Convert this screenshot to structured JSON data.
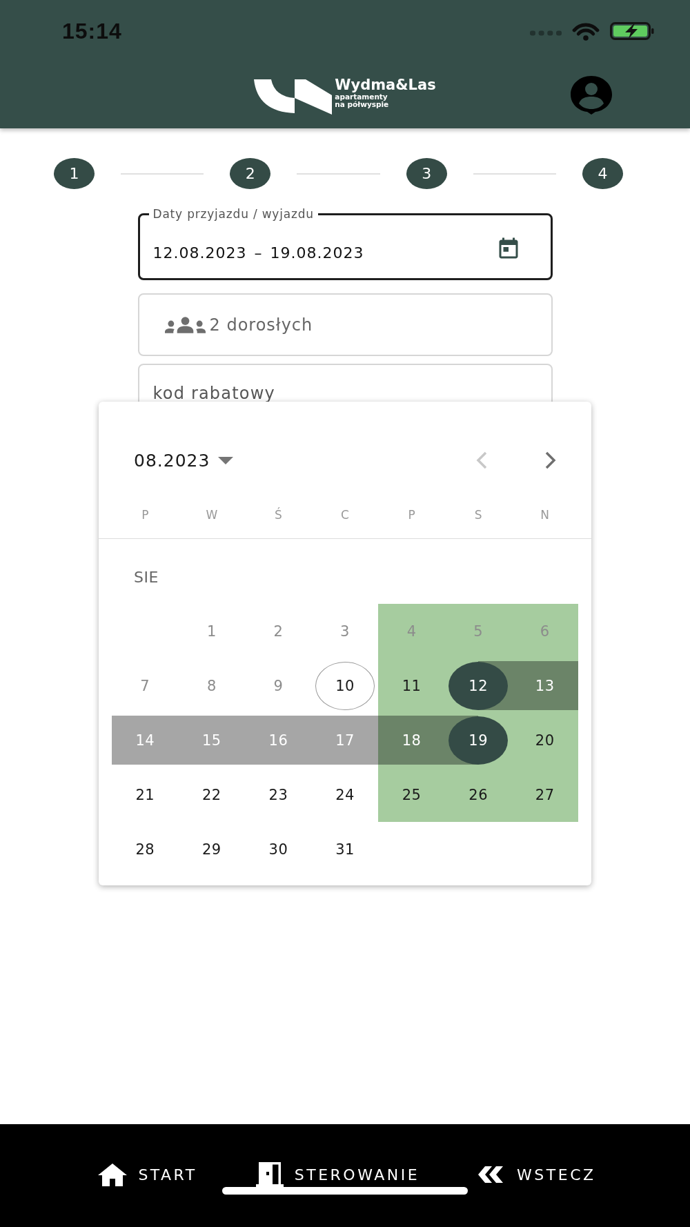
{
  "status_bar": {
    "time": "15:14"
  },
  "header": {
    "brand": {
      "name": "Wydma&Las",
      "tagline": [
        "apartamenty",
        "na półwyspie"
      ]
    }
  },
  "stepper": {
    "steps": [
      "1",
      "2",
      "3",
      "4"
    ]
  },
  "booking_form": {
    "dates": {
      "label": "Daty przyjazdu / wyjazdu",
      "value": "12.08.2023 – 19.08.2023",
      "focused": true
    },
    "guests": {
      "value": "2 dorosłych",
      "focused": false
    },
    "discount_code": {
      "placeholder": "kod rabatowy",
      "focused": false
    }
  },
  "date_picker": {
    "period": "08.2023",
    "prev_disabled": true,
    "next_disabled": false,
    "weekdays": [
      "P",
      "W",
      "Ś",
      "C",
      "P",
      "S",
      "N"
    ],
    "month_label": "SIE",
    "weeks": [
      {
        "days": [
          {
            "kind": "blank"
          },
          {
            "kind": "day",
            "label": "1",
            "disabled": true,
            "highlighted": false,
            "in_range": false,
            "selected": false,
            "today": false
          },
          {
            "kind": "day",
            "label": "2",
            "disabled": true,
            "highlighted": false,
            "in_range": false,
            "selected": false,
            "today": false
          },
          {
            "kind": "day",
            "label": "3",
            "disabled": true,
            "highlighted": false,
            "in_range": false,
            "selected": false,
            "today": false
          },
          {
            "kind": "day",
            "label": "4",
            "disabled": true,
            "highlighted": true,
            "in_range": false,
            "selected": false,
            "today": false
          },
          {
            "kind": "day",
            "label": "5",
            "disabled": true,
            "highlighted": true,
            "in_range": false,
            "selected": false,
            "today": false
          },
          {
            "kind": "day",
            "label": "6",
            "disabled": true,
            "highlighted": true,
            "in_range": false,
            "selected": false,
            "today": false
          }
        ]
      },
      {
        "days": [
          {
            "kind": "day",
            "label": "7",
            "disabled": true,
            "highlighted": false,
            "in_range": false,
            "selected": false,
            "today": false
          },
          {
            "kind": "day",
            "label": "8",
            "disabled": true,
            "highlighted": false,
            "in_range": false,
            "selected": false,
            "today": false
          },
          {
            "kind": "day",
            "label": "9",
            "disabled": true,
            "highlighted": false,
            "in_range": false,
            "selected": false,
            "today": false
          },
          {
            "kind": "day",
            "label": "10",
            "disabled": false,
            "highlighted": false,
            "in_range": false,
            "selected": false,
            "today": true
          },
          {
            "kind": "day",
            "label": "11",
            "disabled": false,
            "highlighted": true,
            "in_range": false,
            "selected": false,
            "today": false
          },
          {
            "kind": "day",
            "label": "12",
            "disabled": false,
            "highlighted": true,
            "in_range": true,
            "selected": true,
            "today": false
          },
          {
            "kind": "day",
            "label": "13",
            "disabled": false,
            "highlighted": true,
            "in_range": true,
            "selected": false,
            "today": false
          }
        ]
      },
      {
        "days": [
          {
            "kind": "day",
            "label": "14",
            "disabled": false,
            "highlighted": false,
            "in_range": true,
            "selected": false,
            "today": false
          },
          {
            "kind": "day",
            "label": "15",
            "disabled": false,
            "highlighted": false,
            "in_range": true,
            "selected": false,
            "today": false
          },
          {
            "kind": "day",
            "label": "16",
            "disabled": false,
            "highlighted": false,
            "in_range": true,
            "selected": false,
            "today": false
          },
          {
            "kind": "day",
            "label": "17",
            "disabled": false,
            "highlighted": false,
            "in_range": true,
            "selected": false,
            "today": false
          },
          {
            "kind": "day",
            "label": "18",
            "disabled": false,
            "highlighted": true,
            "in_range": true,
            "selected": false,
            "today": false
          },
          {
            "kind": "day",
            "label": "19",
            "disabled": false,
            "highlighted": true,
            "in_range": true,
            "selected": true,
            "today": false
          },
          {
            "kind": "day",
            "label": "20",
            "disabled": false,
            "highlighted": true,
            "in_range": false,
            "selected": false,
            "today": false
          }
        ]
      },
      {
        "days": [
          {
            "kind": "day",
            "label": "21",
            "disabled": false,
            "highlighted": false,
            "in_range": false,
            "selected": false,
            "today": false
          },
          {
            "kind": "day",
            "label": "22",
            "disabled": false,
            "highlighted": false,
            "in_range": false,
            "selected": false,
            "today": false
          },
          {
            "kind": "day",
            "label": "23",
            "disabled": false,
            "highlighted": false,
            "in_range": false,
            "selected": false,
            "today": false
          },
          {
            "kind": "day",
            "label": "24",
            "disabled": false,
            "highlighted": false,
            "in_range": false,
            "selected": false,
            "today": false
          },
          {
            "kind": "day",
            "label": "25",
            "disabled": false,
            "highlighted": true,
            "in_range": false,
            "selected": false,
            "today": false
          },
          {
            "kind": "day",
            "label": "26",
            "disabled": false,
            "highlighted": true,
            "in_range": false,
            "selected": false,
            "today": false
          },
          {
            "kind": "day",
            "label": "27",
            "disabled": false,
            "highlighted": true,
            "in_range": false,
            "selected": false,
            "today": false
          }
        ]
      },
      {
        "days": [
          {
            "kind": "day",
            "label": "28",
            "disabled": false,
            "highlighted": false,
            "in_range": false,
            "selected": false,
            "today": false
          },
          {
            "kind": "day",
            "label": "29",
            "disabled": false,
            "highlighted": false,
            "in_range": false,
            "selected": false,
            "today": false
          },
          {
            "kind": "day",
            "label": "30",
            "disabled": false,
            "highlighted": false,
            "in_range": false,
            "selected": false,
            "today": false
          },
          {
            "kind": "day",
            "label": "31",
            "disabled": false,
            "highlighted": false,
            "in_range": false,
            "selected": false,
            "today": false
          }
        ]
      }
    ]
  },
  "bottom_nav": {
    "items": [
      {
        "kind": "home",
        "label": "START"
      },
      {
        "kind": "door",
        "label": "STEROWANIE"
      },
      {
        "kind": "back",
        "label": "WSTECZ"
      }
    ]
  }
}
